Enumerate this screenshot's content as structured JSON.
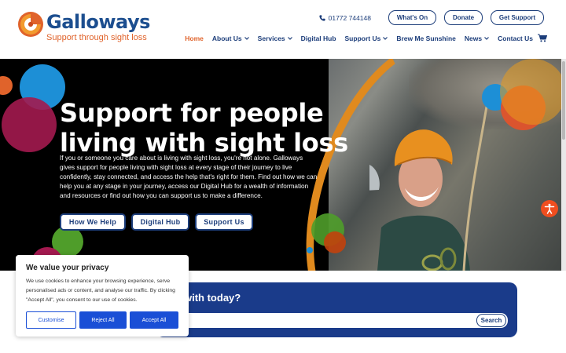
{
  "brand": {
    "name": "Galloways",
    "tagline": "Support through sight loss",
    "colors": {
      "navy": "#1c3d7a",
      "orange": "#e0632b",
      "blue_band": "#1a3b8a",
      "cookie_blue": "#1a4fd6"
    }
  },
  "topbar": {
    "phone": "01772 744148",
    "phone_icon": "phone-icon",
    "buttons": [
      "What's On",
      "Donate",
      "Get Support"
    ]
  },
  "nav": {
    "items": [
      {
        "label": "Home",
        "active": true,
        "dropdown": false
      },
      {
        "label": "About Us",
        "active": false,
        "dropdown": true
      },
      {
        "label": "Services",
        "active": false,
        "dropdown": true
      },
      {
        "label": "Digital Hub",
        "active": false,
        "dropdown": false
      },
      {
        "label": "Support Us",
        "active": false,
        "dropdown": true
      },
      {
        "label": "Brew Me Sunshine",
        "active": false,
        "dropdown": false
      },
      {
        "label": "News",
        "active": false,
        "dropdown": true
      },
      {
        "label": "Contact Us",
        "active": false,
        "dropdown": false
      }
    ],
    "cart_icon": "cart-icon"
  },
  "hero": {
    "title_line1": "Support for people",
    "title_line2": "living with sight loss",
    "text": "If you or someone you care about is living with sight loss, you're not alone. Galloways gives support for people living with sight loss at every stage of their journey to live confidently, stay connected, and access the help that's right for them. Find out how we can help you at any stage in your journey, access our Digital Hub for a wealth of information and resources or find out how you can support us to make a difference.",
    "buttons": [
      "How We Help",
      "Digital Hub",
      "Support Us"
    ]
  },
  "search": {
    "question": "with today?",
    "button": "Search",
    "placeholder": ""
  },
  "cookie": {
    "title": "We value your privacy",
    "text": "We use cookies to enhance your browsing experience, serve personalised ads or content, and analyse our traffic. By clicking \"Accept All\", you consent to our use of cookies.",
    "customise": "Customise",
    "reject": "Reject All",
    "accept": "Accept All"
  },
  "accessibility_icon": "accessibility-icon"
}
